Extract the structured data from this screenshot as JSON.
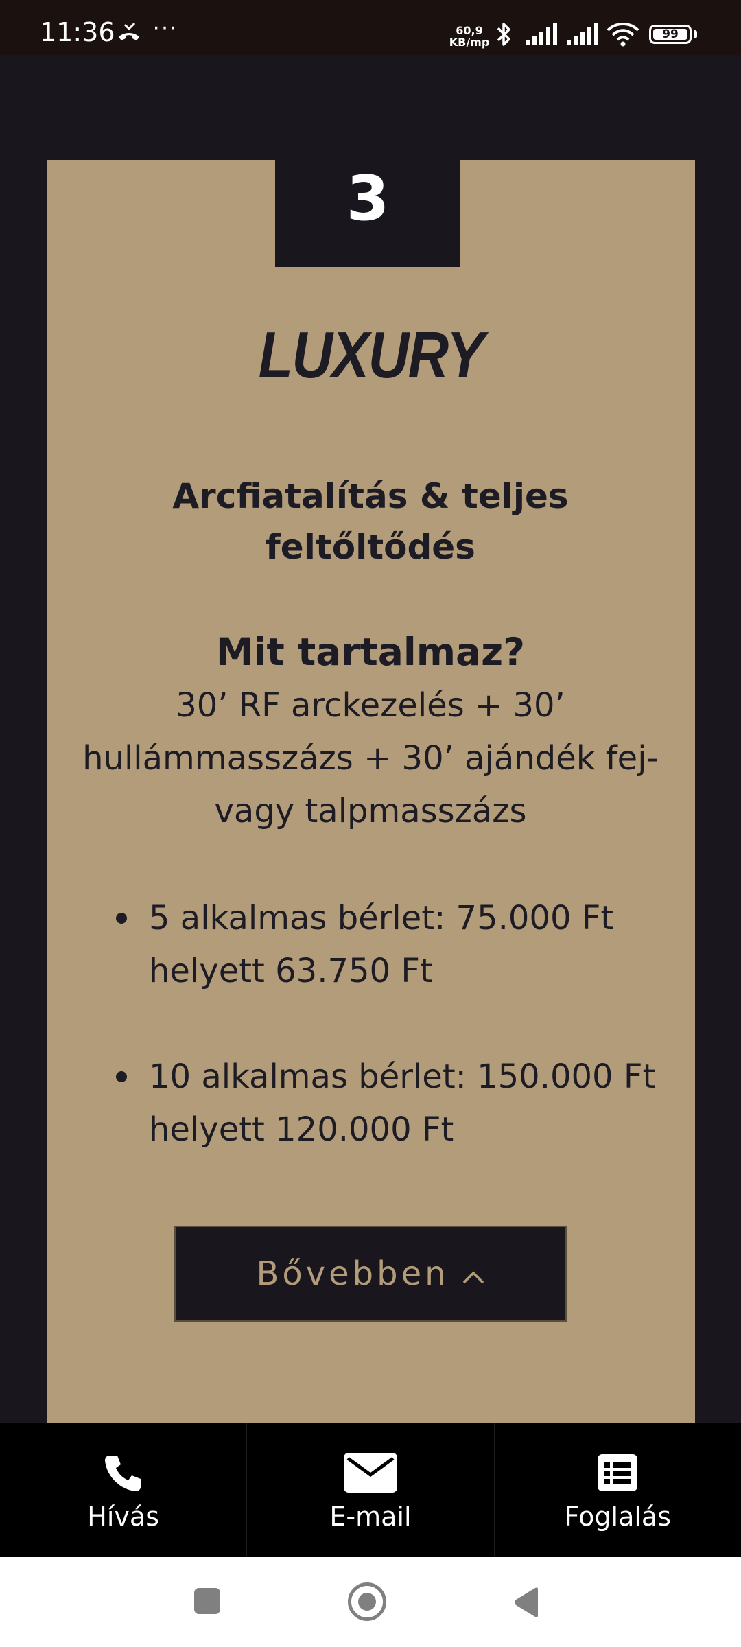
{
  "status_bar": {
    "time": "11:36",
    "more": "···",
    "net_speed_value": "60,9",
    "net_speed_unit": "KB/mp",
    "battery": "99",
    "icons": [
      "missed-call-icon",
      "bluetooth-icon",
      "signal-icon",
      "signal-icon",
      "wifi-icon",
      "battery-icon"
    ]
  },
  "card": {
    "number": "3",
    "title": "LUXURY",
    "subtitle": "Arcfiatalítás & teljes feltőltődés",
    "heading": "Mit tartalmaz?",
    "description": "30’ RF arckezelés + 30’ hullámmasszázs + 30’ ajándék fej- vagy talpmasszázs",
    "prices": [
      "5 alkalmas bérlet: 75.000 Ft helyett 63.750 Ft",
      "10 alkalmas bérlet: 150.000 Ft helyett 120.000 Ft"
    ],
    "more_button": "Bővebben",
    "more_icon": "chevron-up-icon"
  },
  "bottom_bar": {
    "items": [
      {
        "label": "Hívás",
        "icon": "phone-icon"
      },
      {
        "label": "E-mail",
        "icon": "mail-icon"
      },
      {
        "label": "Foglalás",
        "icon": "list-icon"
      }
    ]
  },
  "colors": {
    "background": "#19171d",
    "card": "#b39c79",
    "text_dark": "#1d1b24",
    "bottom_bar": "#000000"
  }
}
